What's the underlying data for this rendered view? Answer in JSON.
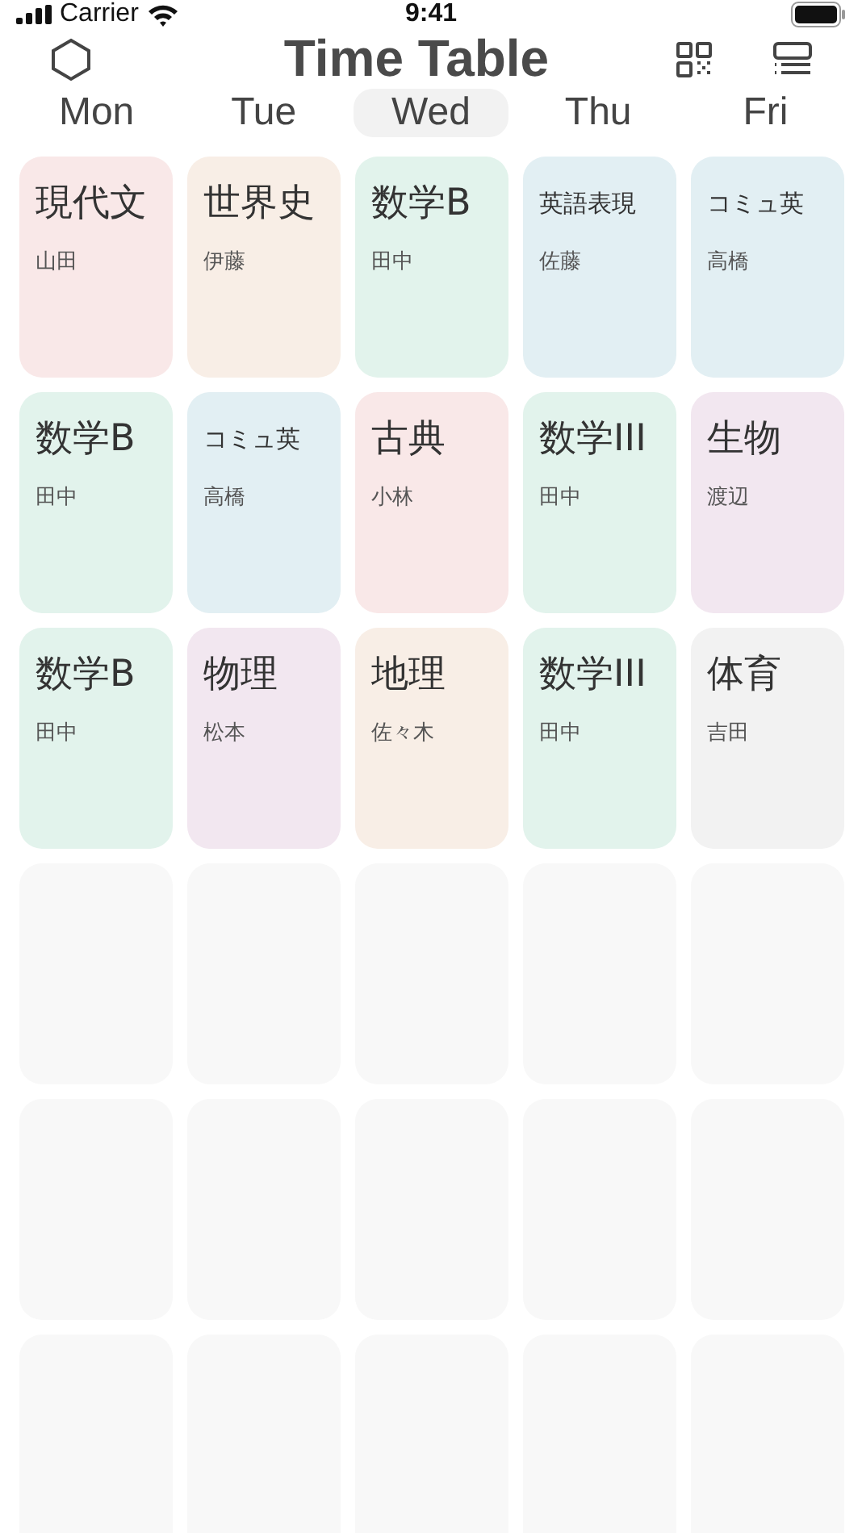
{
  "status_bar": {
    "carrier": "Carrier",
    "time": "9:41"
  },
  "header": {
    "title": "Time Table"
  },
  "days": [
    {
      "label": "Mon",
      "selected": false
    },
    {
      "label": "Tue",
      "selected": false
    },
    {
      "label": "Wed",
      "selected": true
    },
    {
      "label": "Thu",
      "selected": false
    },
    {
      "label": "Fri",
      "selected": false
    }
  ],
  "periods": [
    [
      {
        "kind": "large",
        "subject": "現代文",
        "teacher": "山田",
        "color": "#f9e8e8"
      },
      {
        "kind": "large",
        "subject": "世界史",
        "teacher": "伊藤",
        "color": "#f8eee6"
      },
      {
        "kind": "large",
        "subject": "数学B",
        "teacher": "田中",
        "color": "#e2f3ec"
      },
      {
        "kind": "small",
        "subject": "英語表現",
        "teacher": "佐藤",
        "color": "#e2eff3"
      },
      {
        "kind": "small",
        "subject": "コミュ英",
        "teacher": "高橋",
        "color": "#e2eff3"
      }
    ],
    [
      {
        "kind": "large",
        "subject": "数学B",
        "teacher": "田中",
        "color": "#e2f3ec"
      },
      {
        "kind": "small",
        "subject": "コミュ英",
        "teacher": "高橋",
        "color": "#e2eff3"
      },
      {
        "kind": "large",
        "subject": "古典",
        "teacher": "小林",
        "color": "#f9e8e8"
      },
      {
        "kind": "large",
        "subject": "数学III",
        "teacher": "田中",
        "color": "#e2f3ec"
      },
      {
        "kind": "large",
        "subject": "生物",
        "teacher": "渡辺",
        "color": "#f2e7f0"
      }
    ],
    [
      {
        "kind": "large",
        "subject": "数学B",
        "teacher": "田中",
        "color": "#e2f3ec"
      },
      {
        "kind": "large",
        "subject": "物理",
        "teacher": "松本",
        "color": "#f2e7f0"
      },
      {
        "kind": "large",
        "subject": "地理",
        "teacher": "佐々木",
        "color": "#f8eee6"
      },
      {
        "kind": "large",
        "subject": "数学III",
        "teacher": "田中",
        "color": "#e2f3ec"
      },
      {
        "kind": "large",
        "subject": "体育",
        "teacher": "吉田",
        "color": "#f2f2f2"
      }
    ],
    [
      {
        "kind": "empty",
        "color": "#f8f8f8"
      },
      {
        "kind": "empty",
        "color": "#f8f8f8"
      },
      {
        "kind": "empty",
        "color": "#f8f8f8"
      },
      {
        "kind": "empty",
        "color": "#f8f8f8"
      },
      {
        "kind": "empty",
        "color": "#f8f8f8"
      }
    ],
    [
      {
        "kind": "empty",
        "color": "#f8f8f8"
      },
      {
        "kind": "empty",
        "color": "#f8f8f8"
      },
      {
        "kind": "empty",
        "color": "#f8f8f8"
      },
      {
        "kind": "empty",
        "color": "#f8f8f8"
      },
      {
        "kind": "empty",
        "color": "#f8f8f8"
      }
    ],
    [
      {
        "kind": "empty",
        "color": "#f8f8f8"
      },
      {
        "kind": "empty",
        "color": "#f8f8f8"
      },
      {
        "kind": "empty",
        "color": "#f8f8f8"
      },
      {
        "kind": "empty",
        "color": "#f8f8f8"
      },
      {
        "kind": "empty",
        "color": "#f8f8f8"
      }
    ]
  ]
}
